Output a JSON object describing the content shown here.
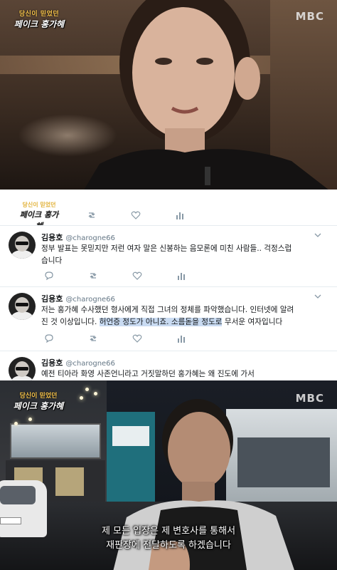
{
  "broadcast": {
    "show_logo_small": "당신이 믿었던",
    "show_logo_big": "페이크 홍가혜",
    "channel_logo": "MBC"
  },
  "tweets_capture": {
    "header_logo_small": "당신이 믿었던",
    "header_logo_big": "페이크 홍가혜",
    "tweets": [
      {
        "name": "김용호",
        "handle": "@charogne66",
        "text": "정부 발표는 못믿지만 저런 여자 말은 신봉하는 음모론에 미친 사람들.. 걱정스럽\n습니다"
      },
      {
        "name": "김용호",
        "handle": "@charogne66",
        "text_before": "저는 홍가혜 수사했던 형사에게 직접 그녀의 정체를 파악했습니다. 인터넷에 알려\n진 것 이상입니다. ",
        "text_highlight": "허언증 정도가 아니죠. 소름돋을 정도로",
        "text_after": " 무서운 여자입니다"
      },
      {
        "name": "김용호",
        "handle": "@charogne66",
        "text": "예전 티아라 화영 사존언니라고 거짓말하던 홍가혜는 왜 진도에 가서\n또 거짓말을 하고 있는가 그때 흐영부터 진솔하다고 해서 용서했하는데"
      }
    ]
  },
  "street_interview": {
    "subtitle_line1": "제 모든 입장은 제 변호사를 통해서",
    "subtitle_line2": "재판장에 전달하도록 하겠습니다"
  },
  "colors": {
    "highlight": "#c9dbf2",
    "twitter_icon_grey": "#8899a6",
    "logo_gold": "#f6c34a"
  },
  "icons": [
    "reply-icon",
    "retweet-icon",
    "like-icon",
    "stats-icon",
    "chevron-down-icon"
  ]
}
